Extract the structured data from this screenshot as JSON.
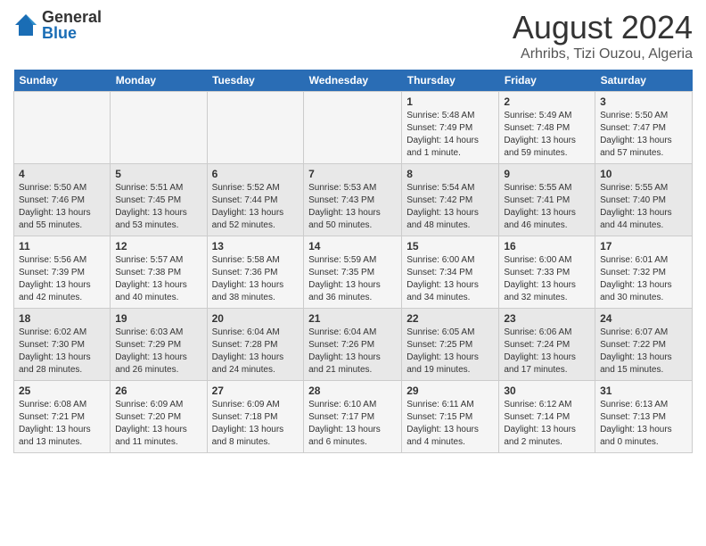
{
  "header": {
    "logo_general": "General",
    "logo_blue": "Blue",
    "month_year": "August 2024",
    "location": "Arhribs, Tizi Ouzou, Algeria"
  },
  "days_of_week": [
    "Sunday",
    "Monday",
    "Tuesday",
    "Wednesday",
    "Thursday",
    "Friday",
    "Saturday"
  ],
  "weeks": [
    [
      {
        "day": "",
        "info": ""
      },
      {
        "day": "",
        "info": ""
      },
      {
        "day": "",
        "info": ""
      },
      {
        "day": "",
        "info": ""
      },
      {
        "day": "1",
        "info": "Sunrise: 5:48 AM\nSunset: 7:49 PM\nDaylight: 14 hours and 1 minute."
      },
      {
        "day": "2",
        "info": "Sunrise: 5:49 AM\nSunset: 7:48 PM\nDaylight: 13 hours and 59 minutes."
      },
      {
        "day": "3",
        "info": "Sunrise: 5:50 AM\nSunset: 7:47 PM\nDaylight: 13 hours and 57 minutes."
      }
    ],
    [
      {
        "day": "4",
        "info": "Sunrise: 5:50 AM\nSunset: 7:46 PM\nDaylight: 13 hours and 55 minutes."
      },
      {
        "day": "5",
        "info": "Sunrise: 5:51 AM\nSunset: 7:45 PM\nDaylight: 13 hours and 53 minutes."
      },
      {
        "day": "6",
        "info": "Sunrise: 5:52 AM\nSunset: 7:44 PM\nDaylight: 13 hours and 52 minutes."
      },
      {
        "day": "7",
        "info": "Sunrise: 5:53 AM\nSunset: 7:43 PM\nDaylight: 13 hours and 50 minutes."
      },
      {
        "day": "8",
        "info": "Sunrise: 5:54 AM\nSunset: 7:42 PM\nDaylight: 13 hours and 48 minutes."
      },
      {
        "day": "9",
        "info": "Sunrise: 5:55 AM\nSunset: 7:41 PM\nDaylight: 13 hours and 46 minutes."
      },
      {
        "day": "10",
        "info": "Sunrise: 5:55 AM\nSunset: 7:40 PM\nDaylight: 13 hours and 44 minutes."
      }
    ],
    [
      {
        "day": "11",
        "info": "Sunrise: 5:56 AM\nSunset: 7:39 PM\nDaylight: 13 hours and 42 minutes."
      },
      {
        "day": "12",
        "info": "Sunrise: 5:57 AM\nSunset: 7:38 PM\nDaylight: 13 hours and 40 minutes."
      },
      {
        "day": "13",
        "info": "Sunrise: 5:58 AM\nSunset: 7:36 PM\nDaylight: 13 hours and 38 minutes."
      },
      {
        "day": "14",
        "info": "Sunrise: 5:59 AM\nSunset: 7:35 PM\nDaylight: 13 hours and 36 minutes."
      },
      {
        "day": "15",
        "info": "Sunrise: 6:00 AM\nSunset: 7:34 PM\nDaylight: 13 hours and 34 minutes."
      },
      {
        "day": "16",
        "info": "Sunrise: 6:00 AM\nSunset: 7:33 PM\nDaylight: 13 hours and 32 minutes."
      },
      {
        "day": "17",
        "info": "Sunrise: 6:01 AM\nSunset: 7:32 PM\nDaylight: 13 hours and 30 minutes."
      }
    ],
    [
      {
        "day": "18",
        "info": "Sunrise: 6:02 AM\nSunset: 7:30 PM\nDaylight: 13 hours and 28 minutes."
      },
      {
        "day": "19",
        "info": "Sunrise: 6:03 AM\nSunset: 7:29 PM\nDaylight: 13 hours and 26 minutes."
      },
      {
        "day": "20",
        "info": "Sunrise: 6:04 AM\nSunset: 7:28 PM\nDaylight: 13 hours and 24 minutes."
      },
      {
        "day": "21",
        "info": "Sunrise: 6:04 AM\nSunset: 7:26 PM\nDaylight: 13 hours and 21 minutes."
      },
      {
        "day": "22",
        "info": "Sunrise: 6:05 AM\nSunset: 7:25 PM\nDaylight: 13 hours and 19 minutes."
      },
      {
        "day": "23",
        "info": "Sunrise: 6:06 AM\nSunset: 7:24 PM\nDaylight: 13 hours and 17 minutes."
      },
      {
        "day": "24",
        "info": "Sunrise: 6:07 AM\nSunset: 7:22 PM\nDaylight: 13 hours and 15 minutes."
      }
    ],
    [
      {
        "day": "25",
        "info": "Sunrise: 6:08 AM\nSunset: 7:21 PM\nDaylight: 13 hours and 13 minutes."
      },
      {
        "day": "26",
        "info": "Sunrise: 6:09 AM\nSunset: 7:20 PM\nDaylight: 13 hours and 11 minutes."
      },
      {
        "day": "27",
        "info": "Sunrise: 6:09 AM\nSunset: 7:18 PM\nDaylight: 13 hours and 8 minutes."
      },
      {
        "day": "28",
        "info": "Sunrise: 6:10 AM\nSunset: 7:17 PM\nDaylight: 13 hours and 6 minutes."
      },
      {
        "day": "29",
        "info": "Sunrise: 6:11 AM\nSunset: 7:15 PM\nDaylight: 13 hours and 4 minutes."
      },
      {
        "day": "30",
        "info": "Sunrise: 6:12 AM\nSunset: 7:14 PM\nDaylight: 13 hours and 2 minutes."
      },
      {
        "day": "31",
        "info": "Sunrise: 6:13 AM\nSunset: 7:13 PM\nDaylight: 13 hours and 0 minutes."
      }
    ]
  ]
}
